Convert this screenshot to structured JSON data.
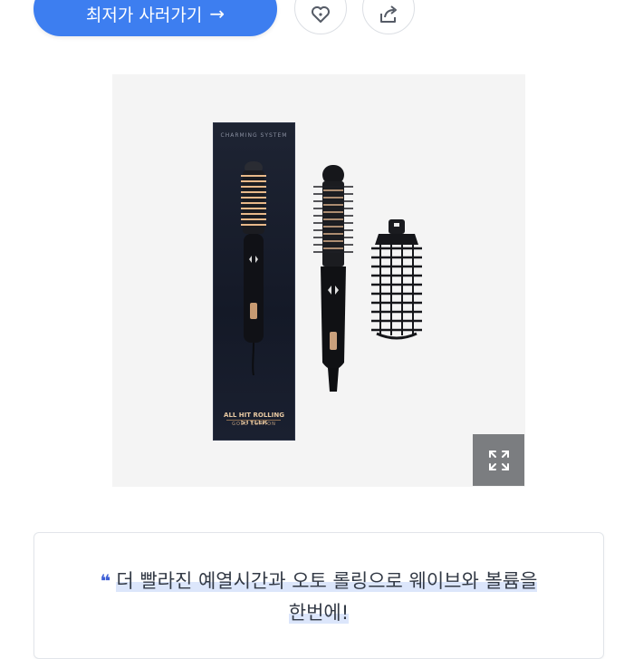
{
  "cta": {
    "label": "최저가 사러가기",
    "arrow": "→"
  },
  "actions": {
    "like_icon": "heart-tag-icon",
    "share_icon": "share-icon"
  },
  "product_image": {
    "box_brand": "CHARMING SYSTEM",
    "box_title": "ALL HIT ROLLING STYLER",
    "box_subtitle": "GOLD EDITION",
    "zoom_icon": "expand-icon"
  },
  "quote": {
    "mark": "❝",
    "line1": "더 빨라진 예열시간과 오토 롤링으로 웨이브와 볼륨을",
    "line2": "한번에!"
  },
  "colors": {
    "accent": "#3d7ef0",
    "quote_mark": "#3d5fd6",
    "zoom_bg": "#7b7d80"
  }
}
